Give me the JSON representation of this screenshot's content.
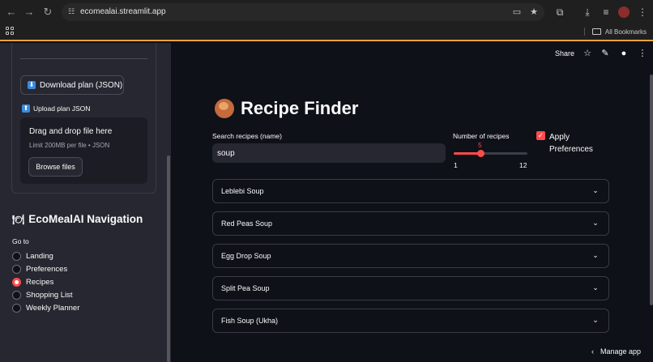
{
  "browser": {
    "url": "ecomealai.streamlit.app",
    "bookmarks_label": "All Bookmarks"
  },
  "sidebar": {
    "download_button": "Download plan (JSON)",
    "upload_label": "Upload plan JSON",
    "dropzone_title": "Drag and drop file here",
    "dropzone_subtitle": "Limit 200MB per file • JSON",
    "browse_button": "Browse files",
    "nav_title": "EcoMealAI Navigation",
    "goto_label": "Go to",
    "nav_items": [
      {
        "label": "Landing",
        "selected": false
      },
      {
        "label": "Preferences",
        "selected": false
      },
      {
        "label": "Recipes",
        "selected": true
      },
      {
        "label": "Shopping List",
        "selected": false
      },
      {
        "label": "Weekly Planner",
        "selected": false
      }
    ]
  },
  "header": {
    "share_label": "Share"
  },
  "main": {
    "title": "Recipe Finder",
    "search_label": "Search recipes (name)",
    "search_value": "soup",
    "slider_label": "Number of recipes",
    "slider_value": "5",
    "slider_min": "1",
    "slider_max": "12",
    "slider_fraction": 0.3636,
    "checkbox_label": "Apply Preferences",
    "checkbox_checked": true,
    "recipes": [
      "Leblebi Soup",
      "Red Peas Soup",
      "Egg Drop Soup",
      "Split Pea Soup",
      "Fish Soup (Ukha)"
    ]
  },
  "footer": {
    "manage_app": "Manage app"
  },
  "colors": {
    "accent": "#ff4b4b",
    "sidebar_bg": "#262730",
    "main_bg": "#0e1117"
  }
}
